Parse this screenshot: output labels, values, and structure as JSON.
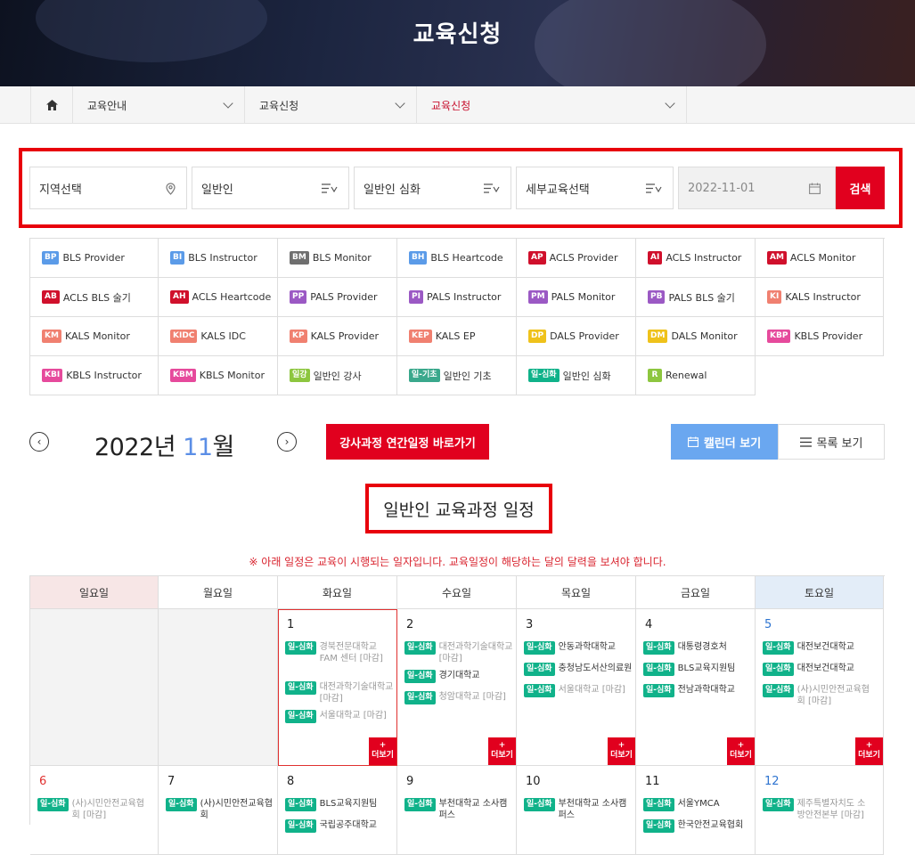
{
  "hero": {
    "title": "교육신청"
  },
  "breadcrumb": {
    "items": [
      {
        "label": "교육안내",
        "active": false
      },
      {
        "label": "교육신청",
        "active": false
      },
      {
        "label": "교육신청",
        "active": true
      }
    ]
  },
  "search": {
    "region": "지역선택",
    "target": "일반인",
    "course": "일반인 심화",
    "detail": "세부교육선택",
    "date": "2022-11-01",
    "button": "검색"
  },
  "legend": [
    {
      "code": "BP",
      "label": "BLS Provider",
      "color": "#5b9be8"
    },
    {
      "code": "BI",
      "label": "BLS Instructor",
      "color": "#5b9be8"
    },
    {
      "code": "BM",
      "label": "BLS Monitor",
      "color": "#6f6f6f"
    },
    {
      "code": "BH",
      "label": "BLS Heartcode",
      "color": "#5b9be8"
    },
    {
      "code": "AP",
      "label": "ACLS Provider",
      "color": "#d0102c"
    },
    {
      "code": "AI",
      "label": "ACLS Instructor",
      "color": "#d0102c"
    },
    {
      "code": "AM",
      "label": "ACLS Monitor",
      "color": "#d0102c"
    },
    {
      "code": "AB",
      "label": "ACLS BLS 술기",
      "color": "#d0102c"
    },
    {
      "code": "AH",
      "label": "ACLS Heartcode",
      "color": "#d0102c"
    },
    {
      "code": "PP",
      "label": "PALS Provider",
      "color": "#9b59c4"
    },
    {
      "code": "PI",
      "label": "PALS Instructor",
      "color": "#9b59c4"
    },
    {
      "code": "PM",
      "label": "PALS Monitor",
      "color": "#9b59c4"
    },
    {
      "code": "PB",
      "label": "PALS BLS 술기",
      "color": "#9b59c4"
    },
    {
      "code": "KI",
      "label": "KALS Instructor",
      "color": "#f08070"
    },
    {
      "code": "KM",
      "label": "KALS Monitor",
      "color": "#f08070"
    },
    {
      "code": "KIDC",
      "label": "KALS IDC",
      "color": "#f08070"
    },
    {
      "code": "KP",
      "label": "KALS Provider",
      "color": "#f08070"
    },
    {
      "code": "KEP",
      "label": "KALS EP",
      "color": "#f08070"
    },
    {
      "code": "DP",
      "label": "DALS Provider",
      "color": "#efc21b"
    },
    {
      "code": "DM",
      "label": "DALS Monitor",
      "color": "#efc21b"
    },
    {
      "code": "KBP",
      "label": "KBLS Provider",
      "color": "#e64a9c"
    },
    {
      "code": "KBI",
      "label": "KBLS Instructor",
      "color": "#e64a9c"
    },
    {
      "code": "KBM",
      "label": "KBLS Monitor",
      "color": "#e64a9c"
    },
    {
      "code": "일강",
      "label": "일반인 강사",
      "color": "#8dc63f"
    },
    {
      "code": "일-기초",
      "label": "일반인 기초",
      "color": "#3aa88c"
    },
    {
      "code": "일-심화",
      "label": "일반인 심화",
      "color": "#10b28a"
    },
    {
      "code": "R",
      "label": "Renewal",
      "color": "#8dc63f"
    }
  ],
  "calendar": {
    "year": "2022년",
    "month": "11",
    "month_suffix": "월",
    "annual_button": "강사과정 연간일정 바로가기",
    "view_calendar": "캘린더 보기",
    "view_list": "목록 보기",
    "schedule_title": "일반인 교육과정 일정",
    "notice": "※ 아래 일정은 교육이 시행되는 일자입니다. 교육일정이 해당하는 달의 달력을 보셔야 합니다.",
    "weekdays": [
      "일요일",
      "월요일",
      "화요일",
      "수요일",
      "목요일",
      "금요일",
      "토요일"
    ],
    "badge": "일-심화",
    "more_plus": "+",
    "more_label": "더보기",
    "week1": [
      {
        "num": "",
        "events": []
      },
      {
        "num": "",
        "events": []
      },
      {
        "num": "1",
        "events": [
          {
            "text": "경북전문대학교 FAM 센터 [마감]",
            "closed": true
          },
          {
            "text": "대전과학기술대학교 [마감]",
            "closed": true
          },
          {
            "text": "서울대학교 [마감]",
            "closed": true
          }
        ]
      },
      {
        "num": "2",
        "events": [
          {
            "text": "대전과학기술대학교 [마감]",
            "closed": true
          },
          {
            "text": "경기대학교",
            "closed": false
          },
          {
            "text": "청암대학교 [마감]",
            "closed": true
          }
        ]
      },
      {
        "num": "3",
        "events": [
          {
            "text": "안동과학대학교",
            "closed": false
          },
          {
            "text": "충청남도서산의료원",
            "closed": false
          },
          {
            "text": "서울대학교 [마감]",
            "closed": true
          }
        ]
      },
      {
        "num": "4",
        "events": [
          {
            "text": "대통령경호처",
            "closed": false
          },
          {
            "text": "BLS교육지원팀",
            "closed": false
          },
          {
            "text": "전남과학대학교",
            "closed": false
          }
        ]
      },
      {
        "num": "5",
        "events": [
          {
            "text": "대전보건대학교",
            "closed": false
          },
          {
            "text": "대전보건대학교",
            "closed": false
          },
          {
            "text": "(사)시민안전교육협회 [마감]",
            "closed": true
          }
        ]
      }
    ],
    "week2": [
      {
        "num": "6",
        "events": [
          {
            "text": "(사)시민안전교육협회 [마감]",
            "closed": true
          }
        ]
      },
      {
        "num": "7",
        "events": [
          {
            "text": "(사)시민안전교육협회",
            "closed": false
          }
        ]
      },
      {
        "num": "8",
        "events": [
          {
            "text": "BLS교육지원팀",
            "closed": false
          },
          {
            "text": "국립공주대학교",
            "closed": false
          }
        ]
      },
      {
        "num": "9",
        "events": [
          {
            "text": "부천대학교 소사캠퍼스",
            "closed": false
          }
        ]
      },
      {
        "num": "10",
        "events": [
          {
            "text": "부천대학교 소사캠퍼스",
            "closed": false
          }
        ]
      },
      {
        "num": "11",
        "events": [
          {
            "text": "서울YMCA",
            "closed": false
          },
          {
            "text": "한국안전교육협회",
            "closed": false
          }
        ]
      },
      {
        "num": "12",
        "events": [
          {
            "text": "제주특별자치도 소방안전본부 [마감]",
            "closed": true
          }
        ]
      }
    ]
  }
}
